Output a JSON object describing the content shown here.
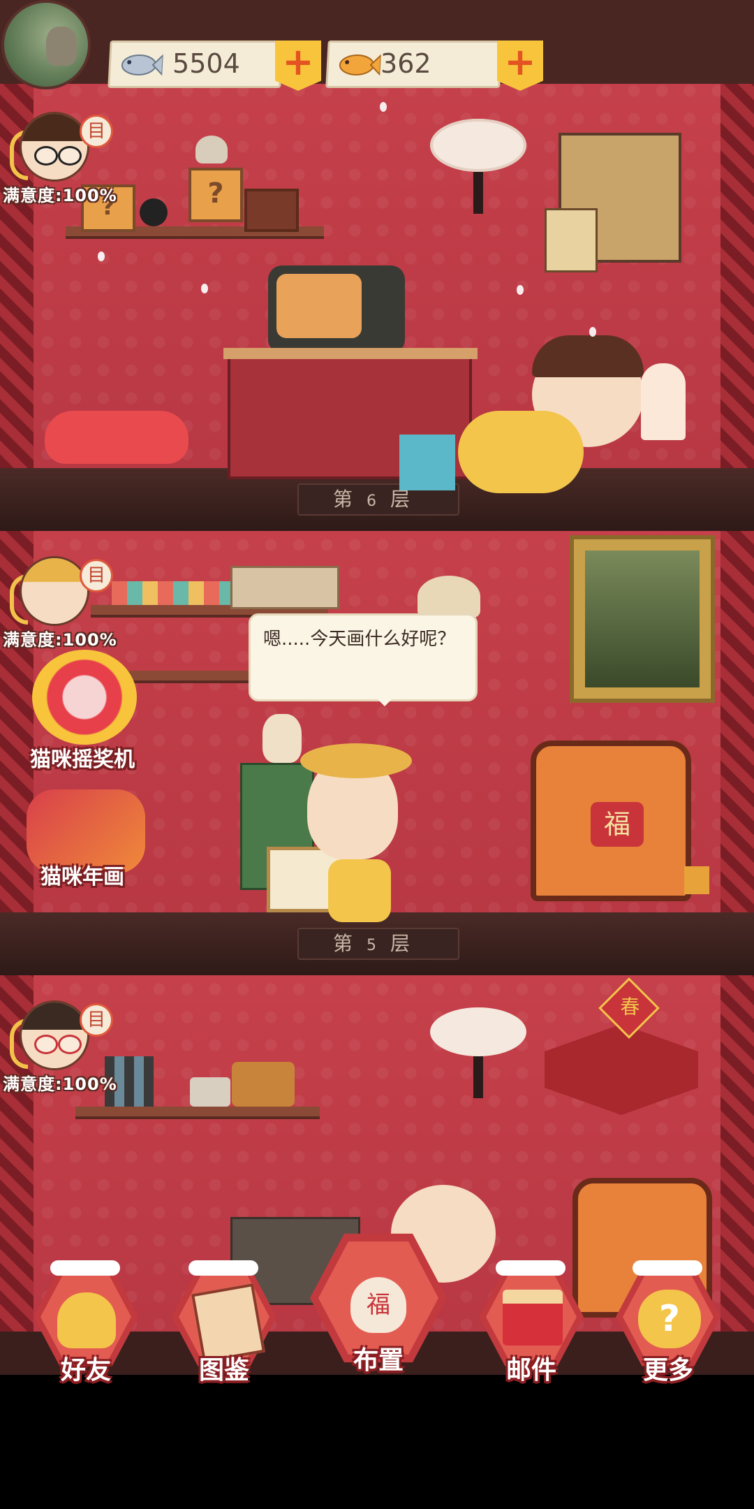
{
  "currencies": [
    {
      "name": "silver-fish",
      "value": "5504",
      "color": "#b8c4d4"
    },
    {
      "name": "gold-fish",
      "value": "362",
      "color": "#f2a53a"
    }
  ],
  "floors": [
    {
      "label_prefix": "第",
      "number": "6",
      "label_suffix": "层",
      "resident": {
        "satisfaction": "满意度:100%",
        "memo_icon": "目"
      }
    },
    {
      "label_prefix": "第",
      "number": "5",
      "label_suffix": "层",
      "resident": {
        "satisfaction": "满意度:100%",
        "memo_icon": "目"
      },
      "speech": "嗯.....今天画什么好呢？"
    },
    {
      "resident": {
        "satisfaction": "满意度:100%",
        "memo_icon": "目"
      }
    }
  ],
  "features": [
    {
      "label": "猫咪摇奖机"
    },
    {
      "label": "猫咪年画"
    }
  ],
  "nav": [
    {
      "label": "好友"
    },
    {
      "label": "图鉴"
    },
    {
      "label": "布置"
    },
    {
      "label": "邮件"
    },
    {
      "label": "更多"
    }
  ],
  "decor": {
    "fu_char": "福",
    "spring_char": "春"
  },
  "colors": {
    "wall": "#c5404a",
    "accent_gold": "#f7c43c",
    "dark_wood": "#4a2622"
  }
}
